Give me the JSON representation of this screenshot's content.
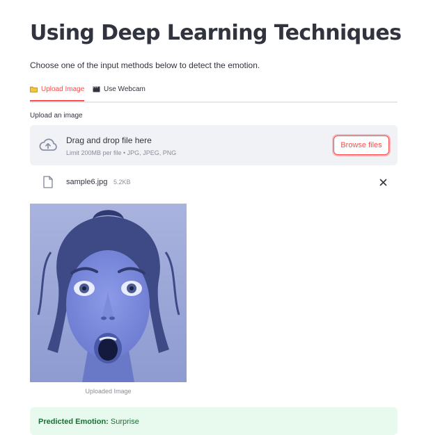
{
  "page": {
    "title": "Using Deep Learning Techniques",
    "subtitle": "Choose one of the input methods below to detect the emotion."
  },
  "tabs": [
    {
      "label": "Upload Image",
      "icon": "folder-icon",
      "active": true
    },
    {
      "label": "Use Webcam",
      "icon": "clapperboard-icon",
      "active": false
    }
  ],
  "uploader": {
    "label": "Upload an image",
    "drop_text": "Drag and drop file here",
    "limit_text": "Limit 200MB per file • JPG, JPEG, PNG",
    "browse_label": "Browse files"
  },
  "file": {
    "name": "sample6.jpg",
    "size": "5.2KB"
  },
  "image": {
    "caption": "Uploaded Image"
  },
  "result": {
    "label": "Predicted Emotion:",
    "value": "Surprise"
  },
  "colors": {
    "accent": "#ff4b4b",
    "success_bg": "#e8f9ee",
    "success_text": "#177233",
    "dropzone_bg": "#f0f2f6"
  }
}
